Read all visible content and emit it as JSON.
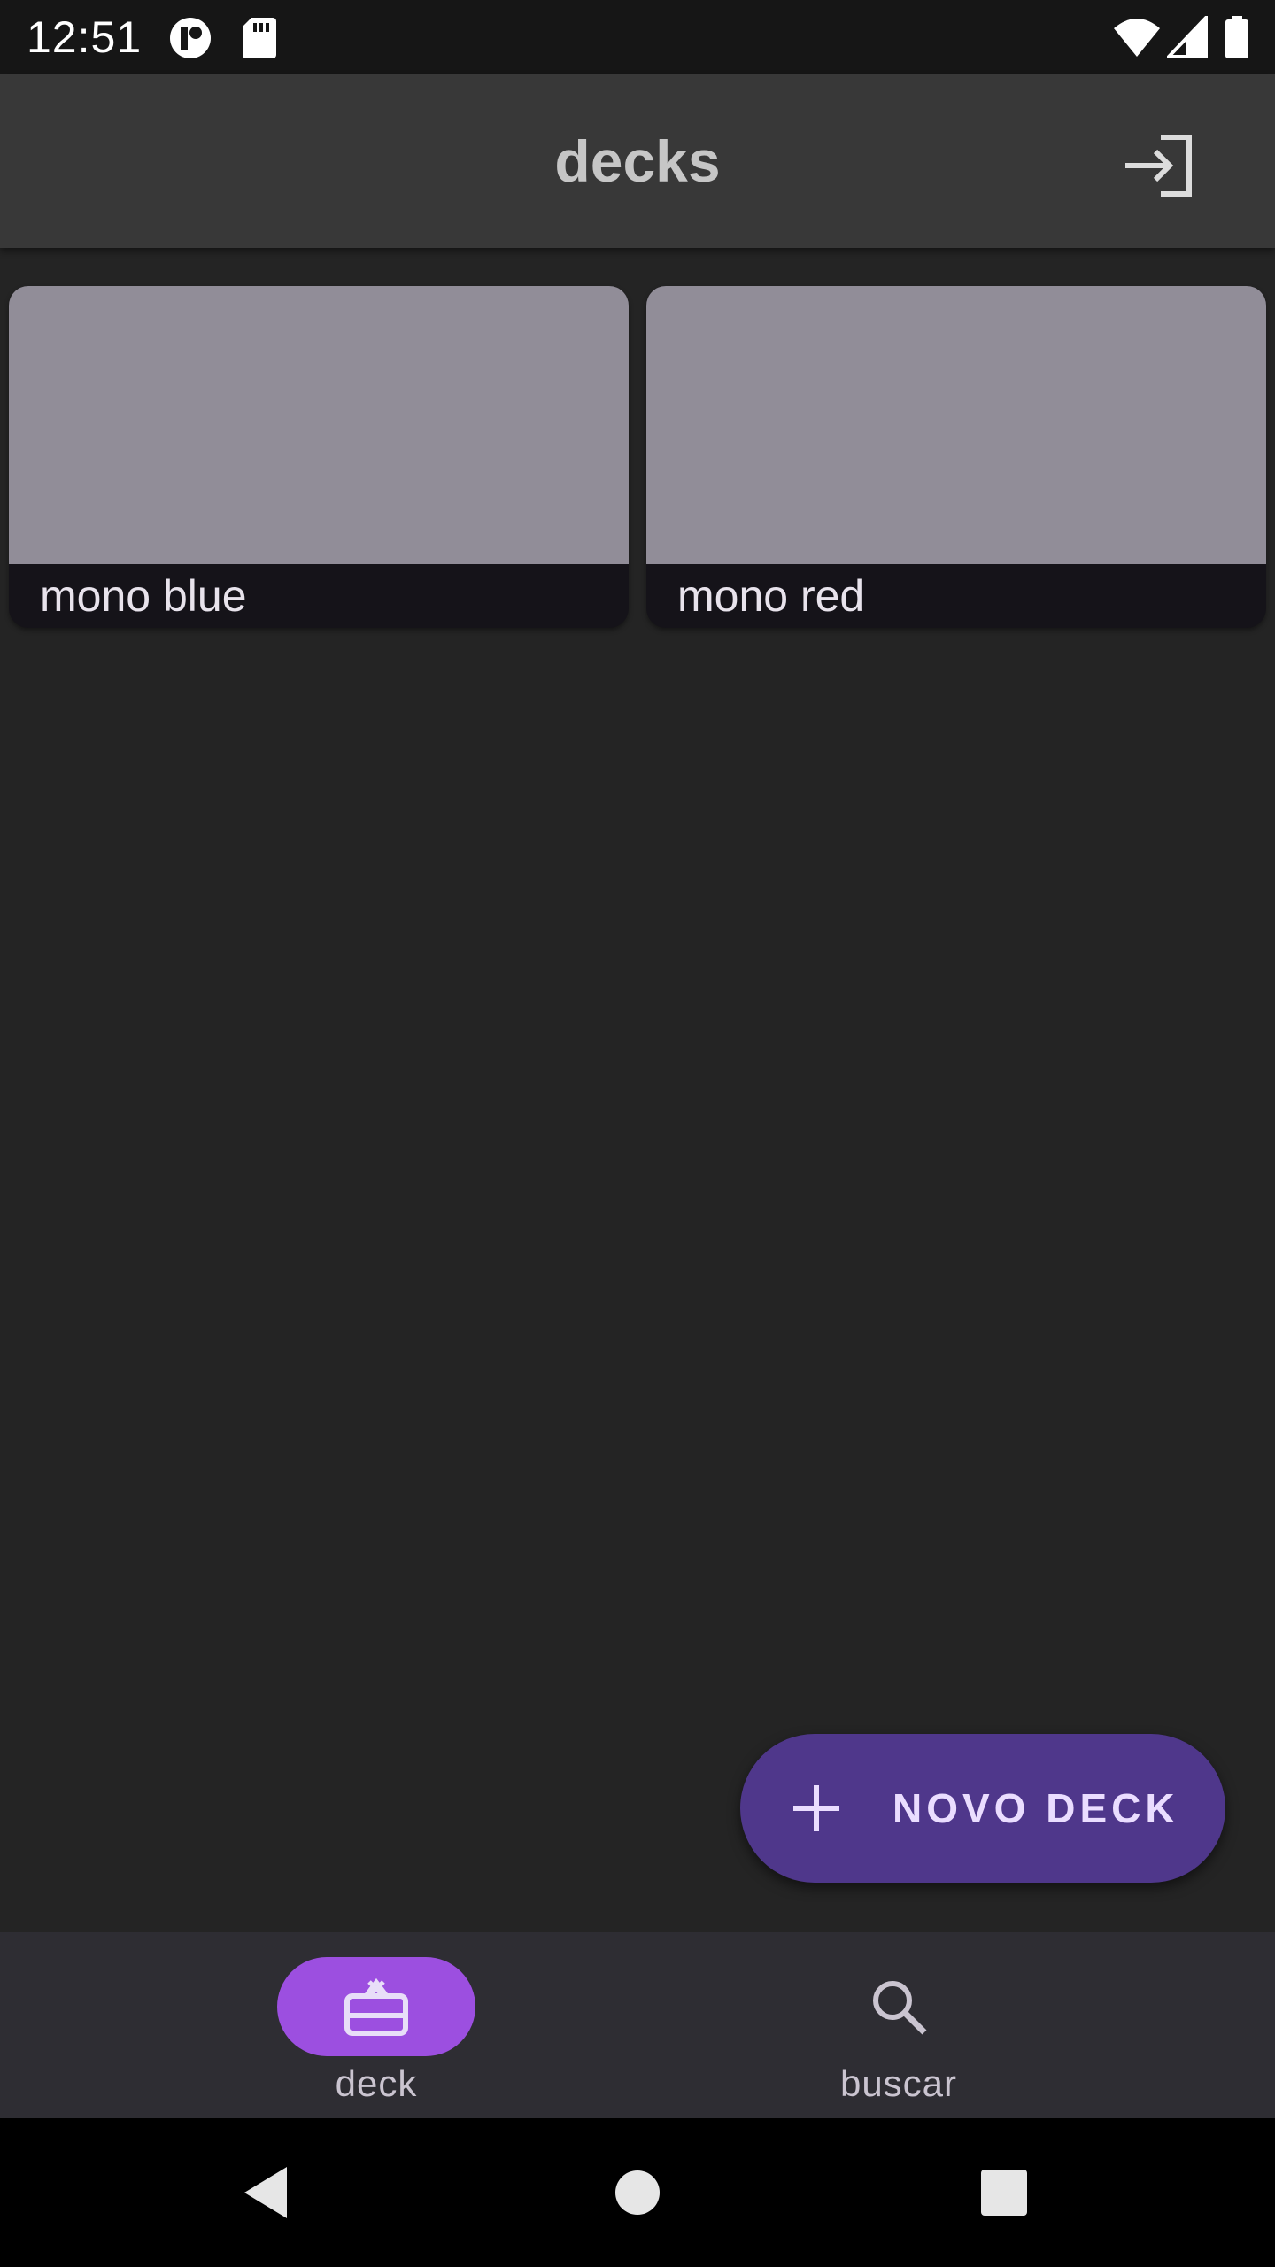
{
  "status_bar": {
    "time": "12:51",
    "icons": [
      "data-saver-icon",
      "sd-card-icon",
      "wifi-icon",
      "cell-signal-icon",
      "battery-icon"
    ]
  },
  "app_bar": {
    "title": "decks",
    "action_icon": "login-icon"
  },
  "decks": [
    {
      "name": "mono blue"
    },
    {
      "name": "mono red"
    }
  ],
  "fab": {
    "label": "NOVO DECK",
    "icon": "plus-icon"
  },
  "bottom_nav": {
    "items": [
      {
        "label": "deck",
        "icon": "cards-icon",
        "active": true
      },
      {
        "label": "buscar",
        "icon": "search-icon",
        "active": false
      }
    ]
  },
  "system_nav": {
    "buttons": [
      "back-icon",
      "home-icon",
      "recents-icon"
    ]
  },
  "colors": {
    "background": "#242424",
    "app_bar": "#383838",
    "card_image": "#918d98",
    "card_footer": "#151319",
    "fab": "#4f378b",
    "nav_active": "#9c4fe0",
    "bottom_nav": "#2e2d33"
  }
}
